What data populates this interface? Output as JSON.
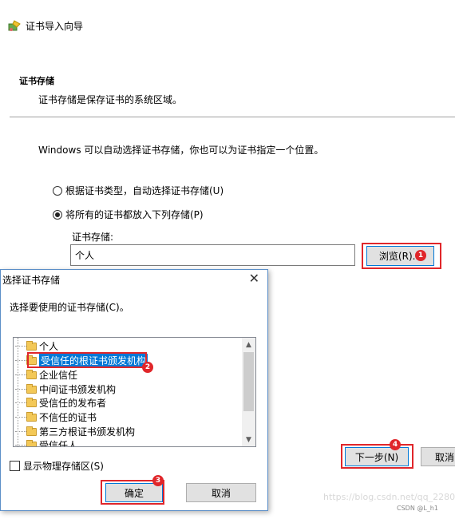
{
  "wizard": {
    "title": "证书导入向导",
    "heading": "证书存储",
    "subheading": "证书存储是保存证书的系统区域。",
    "description": "Windows 可以自动选择证书存储，你也可以为证书指定一个位置。",
    "option_auto": "根据证书类型，自动选择证书存储(U)",
    "option_manual": "将所有的证书都放入下列存储(P)",
    "store_label": "证书存储:",
    "store_value": "个人",
    "browse_label": "浏览(R)...",
    "next_label": "下一步(N)",
    "cancel_label": "取消"
  },
  "dialog": {
    "title": "选择证书存储",
    "close_glyph": "✕",
    "prompt": "选择要使用的证书存储(C)。",
    "stores": [
      "个人",
      "受信任的根证书颁发机构",
      "企业信任",
      "中间证书颁发机构",
      "受信任的发布者",
      "不信任的证书",
      "第三方根证书颁发机构",
      "受信任人"
    ],
    "selected_index": 1,
    "show_physical_label": "显示物理存储区(S)",
    "ok_label": "确定",
    "cancel_label": "取消"
  },
  "annotations": {
    "badges": [
      "1",
      "2",
      "3",
      "4"
    ],
    "color": "#e0262a"
  },
  "scroll_glyphs": {
    "up": "▲",
    "down": "▼"
  },
  "watermark": {
    "url": "https://blog.csdn.net/qq_2280",
    "credit": "CSDN @L_h1"
  },
  "colors": {
    "accent": "#0078d7",
    "folder": "#f3c857"
  }
}
